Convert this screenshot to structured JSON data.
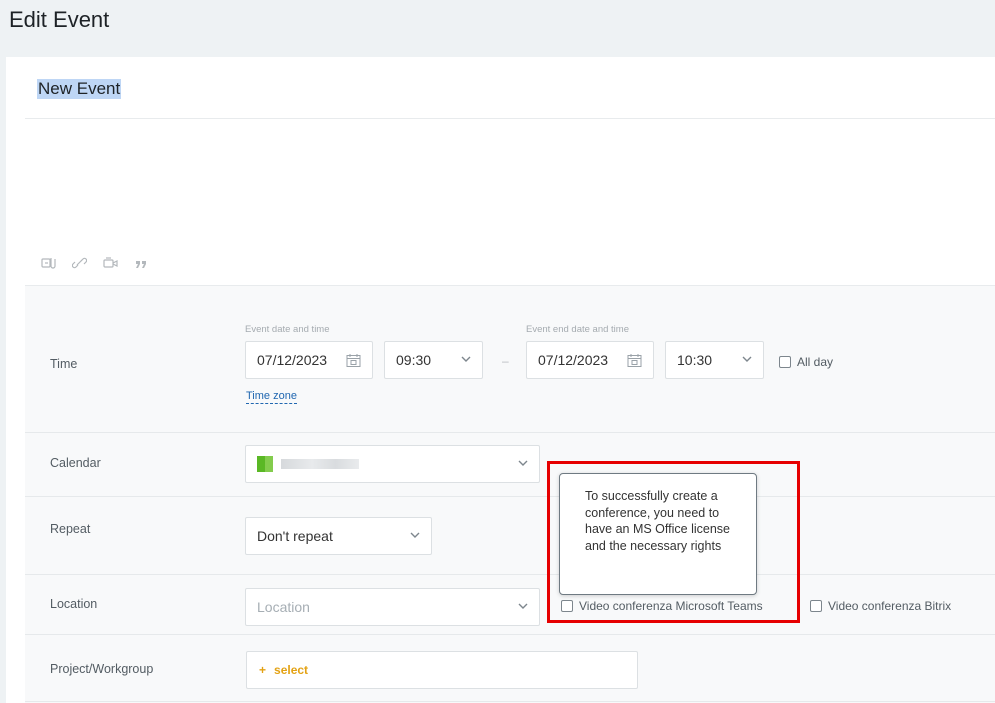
{
  "page": {
    "title": "Edit Event"
  },
  "event": {
    "name": "New Event"
  },
  "toolbar": {
    "icons": [
      "attach-file-icon",
      "link-icon",
      "video-icon",
      "quote-icon"
    ]
  },
  "form": {
    "time": {
      "label": "Time",
      "start_caption": "Event date and time",
      "start_date": "07/12/2023",
      "start_time": "09:30",
      "separator": "–",
      "end_caption": "Event end date and time",
      "end_date": "07/12/2023",
      "end_time": "10:30",
      "all_day_label": "All day",
      "timezone_link": "Time zone"
    },
    "calendar": {
      "label": "Calendar"
    },
    "repeat": {
      "label": "Repeat",
      "value": "Don't repeat"
    },
    "location": {
      "label": "Location",
      "placeholder": "Location",
      "teams_label": "Video conferenza Microsoft Teams",
      "bitrix_label": "Video conferenza Bitrix"
    },
    "project": {
      "label": "Project/Workgroup",
      "select_label": "select",
      "plus": "+"
    }
  },
  "tooltip": {
    "text": "To successfully create a conference, you need to have an MS Office license and the necessary rights"
  },
  "colors": {
    "accent_link": "#2067b0",
    "select_orange": "#e3a214",
    "highlight_red": "#e60000",
    "selection_blue": "#bed6f5"
  }
}
